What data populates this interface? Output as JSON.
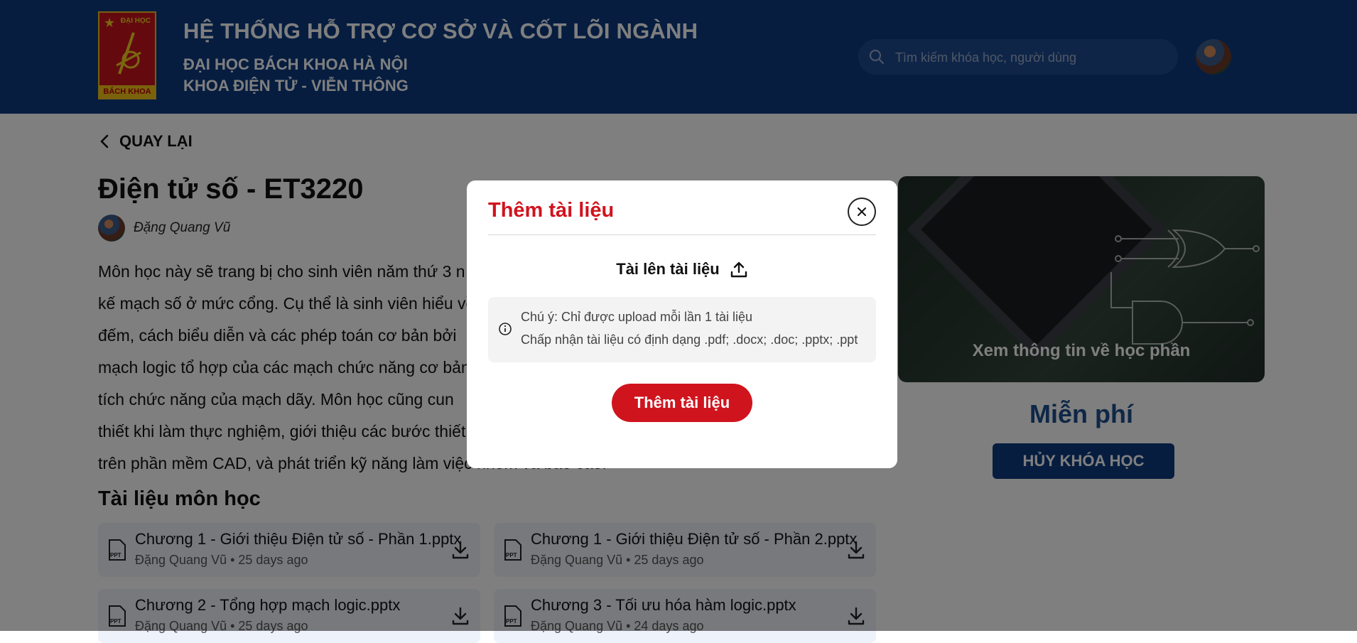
{
  "header": {
    "system_title": "HỆ THỐNG HỖ TRỢ CƠ SỞ VÀ CỐT LÕI NGÀNH",
    "university": "ĐẠI HỌC BÁCH KHOA HÀ NỘI",
    "faculty": "KHOA ĐIỆN TỬ - VIỄN THÔNG",
    "logo_top_text": "ĐẠI HỌC",
    "logo_bottom_text": "BÁCH KHOA",
    "search_placeholder": "Tìm kiếm khóa học, người dùng"
  },
  "course": {
    "back_label": "QUAY LẠI",
    "title": "Điện tử số - ET3220",
    "author": "Đặng Quang Vũ",
    "description_lines": [
      "Môn học này sẽ trang bị cho sinh viên năm thứ 3 n",
      "kế mạch số ở mức cổng. Cụ thể là sinh viên hiểu về",
      "đếm, cách biểu diễn và các phép toán cơ bản bởi",
      "mạch logic tổ hợp của các mạch chức năng cơ bản",
      "tích chức năng của mạch dãy. Môn học cũng cun",
      "thiết khi làm thực nghiệm, giới thiệu các bước thiết",
      "trên phần mềm CAD, và phát triển kỹ năng làm việc nhóm và báo cáo."
    ],
    "docs_heading": "Tài liệu môn học",
    "documents": [
      {
        "name": "Chương 1 - Giới thiệu Điện tử số - Phần 1.pptx",
        "meta": "Đặng Quang Vũ • 25 days ago"
      },
      {
        "name": "Chương 1 - Giới thiệu Điện tử số - Phần 2.pptx",
        "meta": "Đặng Quang Vũ • 25 days ago"
      },
      {
        "name": "Chương 2 - Tổng hợp mạch logic.pptx",
        "meta": "Đặng Quang Vũ • 25 days ago"
      },
      {
        "name": "Chương 3 - Tối ưu hóa hàm logic.pptx",
        "meta": "Đặng Quang Vũ • 24 days ago"
      }
    ],
    "file_icon_label": "PPT"
  },
  "sidebar": {
    "card_cta": "Xem thông tin về học phần",
    "price": "Miễn phí",
    "cancel_label": "HỦY KHÓA HỌC"
  },
  "modal": {
    "title": "Thêm tài liệu",
    "upload_label": "Tài lên tài liệu",
    "note_line1": "Chú ý: Chỉ được upload mỗi lần 1 tài liệu",
    "note_line2": "Chấp nhận tài liệu có định dạng .pdf; .docx; .doc; .pptx; .ppt",
    "submit_label": "Thêm tài liệu"
  },
  "colors": {
    "header_bg": "#0c3b80",
    "accent_red": "#d0141e",
    "price_blue": "#1f4f8f",
    "doc_card_bg": "#eef2fb"
  }
}
